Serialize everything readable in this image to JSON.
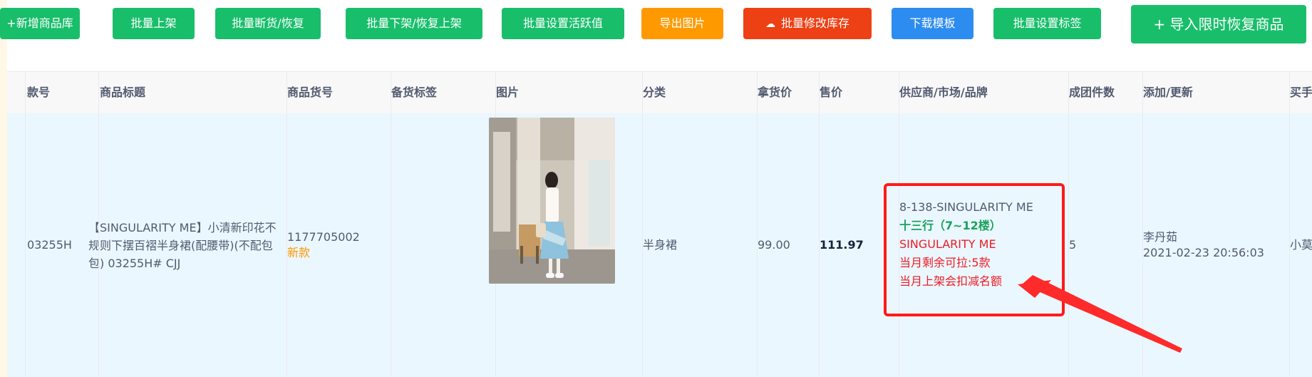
{
  "toolbar": {
    "buttons": [
      {
        "label": "+新增商品库",
        "color": "green"
      },
      {
        "label": "批量上架",
        "color": "green"
      },
      {
        "label": "批量断货/恢复",
        "color": "green"
      },
      {
        "label": "批量下架/恢复上架",
        "color": "green"
      },
      {
        "label": "批量设置活跃值",
        "color": "green"
      },
      {
        "label": "导出图片",
        "color": "orange"
      },
      {
        "label": "批量修改库存",
        "color": "red",
        "icon": "cloud-upload-icon"
      },
      {
        "label": "下载模板",
        "color": "blue"
      },
      {
        "label": "批量设置标签",
        "color": "green"
      },
      {
        "label": "+ 导入限时恢复商品",
        "color": "green"
      }
    ]
  },
  "table": {
    "headers": [
      "款号",
      "商品标题",
      "商品货号",
      "备货标签",
      "图片",
      "分类",
      "拿货价",
      "售价",
      "供应商/市场/品牌",
      "成团件数",
      "添加/更新",
      "买手"
    ],
    "row": {
      "style_no": "03255H",
      "title": "【SINGULARITY ME】小清新印花不规则下摆百褶半身裙(配腰带)(不配包包) 03255H# CJJ",
      "sku": "1177705002",
      "sku_tag": "新款",
      "stock_tag": "",
      "image_alt": "product-photo",
      "category": "半身裙",
      "cost_price": "99.00",
      "sale_price": "111.97",
      "supplier": {
        "code": "8-138-SINGULARITY ME",
        "market": "十三行（7~12楼）",
        "brand": "SINGULARITY ME",
        "remaining": "当月剩余可拉:5款",
        "note": "当月上架会扣减名额"
      },
      "group_qty": "5",
      "added_by": "李丹茹",
      "updated_at": "2021-02-23 20:56:03",
      "buyer": "小莫"
    }
  },
  "colors": {
    "green": "#19be6b",
    "orange": "#ff9900",
    "red": "#ed4014",
    "blue": "#2d8cf0",
    "highlight": "#ff1a1a"
  }
}
